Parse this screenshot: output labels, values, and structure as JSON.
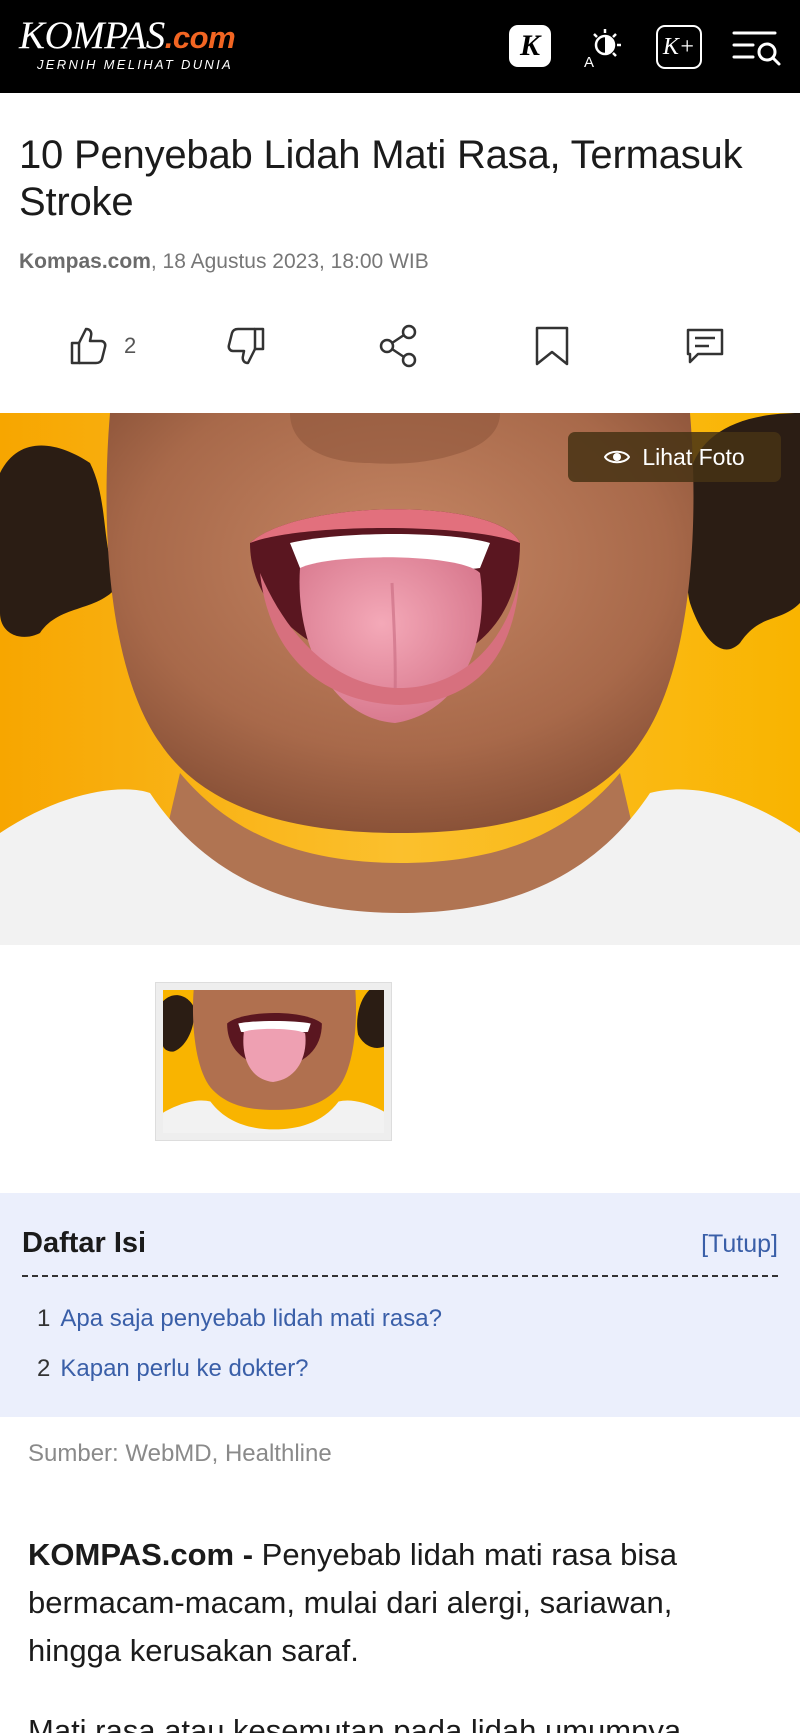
{
  "header": {
    "logo_main": "KOMPAS",
    "logo_suffix": ".com",
    "logo_tagline": "JERNIH MELIHAT DUNIA",
    "k_button": "K",
    "kplus_button": "K+"
  },
  "article": {
    "title": "10 Penyebab Lidah Mati Rasa, Termasuk Stroke",
    "source_name": "Kompas.com",
    "date": ", 18 Agustus 2023, 18:00 WIB",
    "like_count": "2"
  },
  "hero": {
    "view_photo_label": "Lihat Foto"
  },
  "toc": {
    "title": "Daftar Isi",
    "toggle_label": "[Tutup]",
    "items": [
      {
        "num": "1",
        "label": "Apa saja penyebab lidah mati rasa?"
      },
      {
        "num": "2",
        "label": "Kapan perlu ke dokter?"
      }
    ]
  },
  "body": {
    "source_note": "Sumber: WebMD, Healthline",
    "lead_brand": "KOMPAS.com - ",
    "lead_text": "Penyebab lidah mati rasa bisa bermacam-macam, mulai dari alergi, sariawan, hingga kerusakan saraf.",
    "next_paragraph": "Mati rasa atau kesemutan pada lidah umumnya"
  },
  "colors": {
    "header_bg": "#000000",
    "brand_orange": "#f26522",
    "toc_bg": "#ebeffc",
    "link_blue": "#3a5fa8"
  }
}
